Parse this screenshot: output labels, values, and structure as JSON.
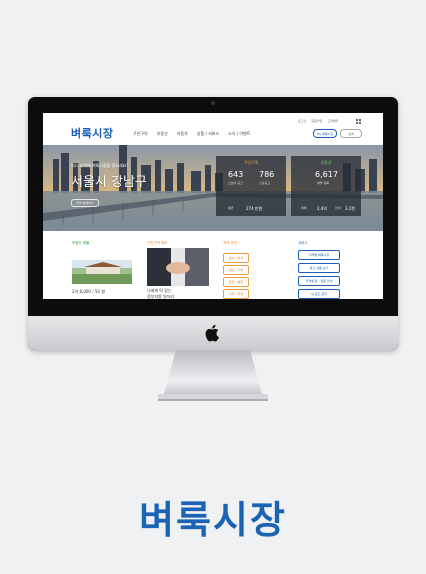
{
  "site": {
    "logo": "벼룩시장",
    "nav": [
      "구인구직",
      "부동산",
      "자동차",
      "상품 / 서비스",
      "소식 / 이벤트"
    ],
    "util": [
      "로그인",
      "회원가입",
      "고객센터"
    ],
    "btn_post": "My 벼룩시장",
    "btn_search": "검색"
  },
  "hero": {
    "question": "어느 지역에 벼룩시장을 찾으세요?",
    "title": "서울시 강남구",
    "region_button": "지역 변경하기",
    "panel_jobs": {
      "title": "구인구직",
      "v1": "643",
      "l1": "오늘의 공고",
      "v2": "786",
      "l2": "신규공고",
      "v3": "274 만원",
      "l3": "평균"
    },
    "panel_estate": {
      "title": "부동산",
      "v1": "6,617",
      "l1": "매물 등록",
      "v2": "2.4억",
      "l2": "매매",
      "v3": "3.2천",
      "l3": "전세"
    }
  },
  "lower": {
    "col1_title": "부동산 매물",
    "col2_title": "구인구직 정보",
    "col3_title": "지역 추천",
    "col4_title": "서비스",
    "cap1": "2억 8,000 / 50 평",
    "cap2_1": "나에게 딱 맞는",
    "cap2_2": "정부지원 일자리",
    "tags": [
      "음식 · 외식",
      "생산 · 기술",
      "운전 · 배달",
      "사무 · 회계"
    ],
    "links": [
      "지역별 벼룩시장",
      "중고 상품 보기",
      "지역별 동 · 업종 안내",
      "내 광고 관리"
    ]
  },
  "brand": {
    "name": "벼룩시장"
  },
  "colors": {
    "brand_blue": "#1b63b5",
    "accent_orange": "#f0a040",
    "accent_green": "#7ed66b"
  }
}
